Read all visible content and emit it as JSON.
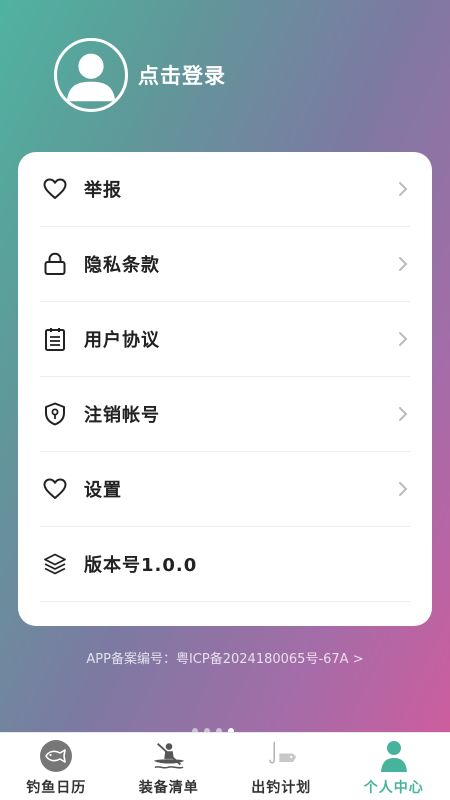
{
  "header": {
    "login_label": "点击登录"
  },
  "menu": {
    "items": [
      {
        "label": "举报",
        "icon": "heart-icon"
      },
      {
        "label": "隐私条款",
        "icon": "lock-icon"
      },
      {
        "label": "用户协议",
        "icon": "document-icon"
      },
      {
        "label": "注销帐号",
        "icon": "shield-icon"
      },
      {
        "label": "设置",
        "icon": "heart-icon"
      },
      {
        "label": "版本号1.0.0",
        "icon": "layers-icon"
      }
    ]
  },
  "footer": {
    "icp_text": "APP备案编号：粤ICP备2024180065号-67A >"
  },
  "tabbar": {
    "tabs": [
      {
        "label": "钓鱼日历",
        "icon": "fish-icon",
        "active": false
      },
      {
        "label": "装备清单",
        "icon": "kayak-icon",
        "active": false
      },
      {
        "label": "出钓计划",
        "icon": "fishhook-icon",
        "active": false
      },
      {
        "label": "个人中心",
        "icon": "person-icon",
        "active": true
      }
    ]
  },
  "colors": {
    "accent": "#47b39c",
    "gradient_start": "#4fb3a0",
    "gradient_end": "#d55b9c"
  }
}
